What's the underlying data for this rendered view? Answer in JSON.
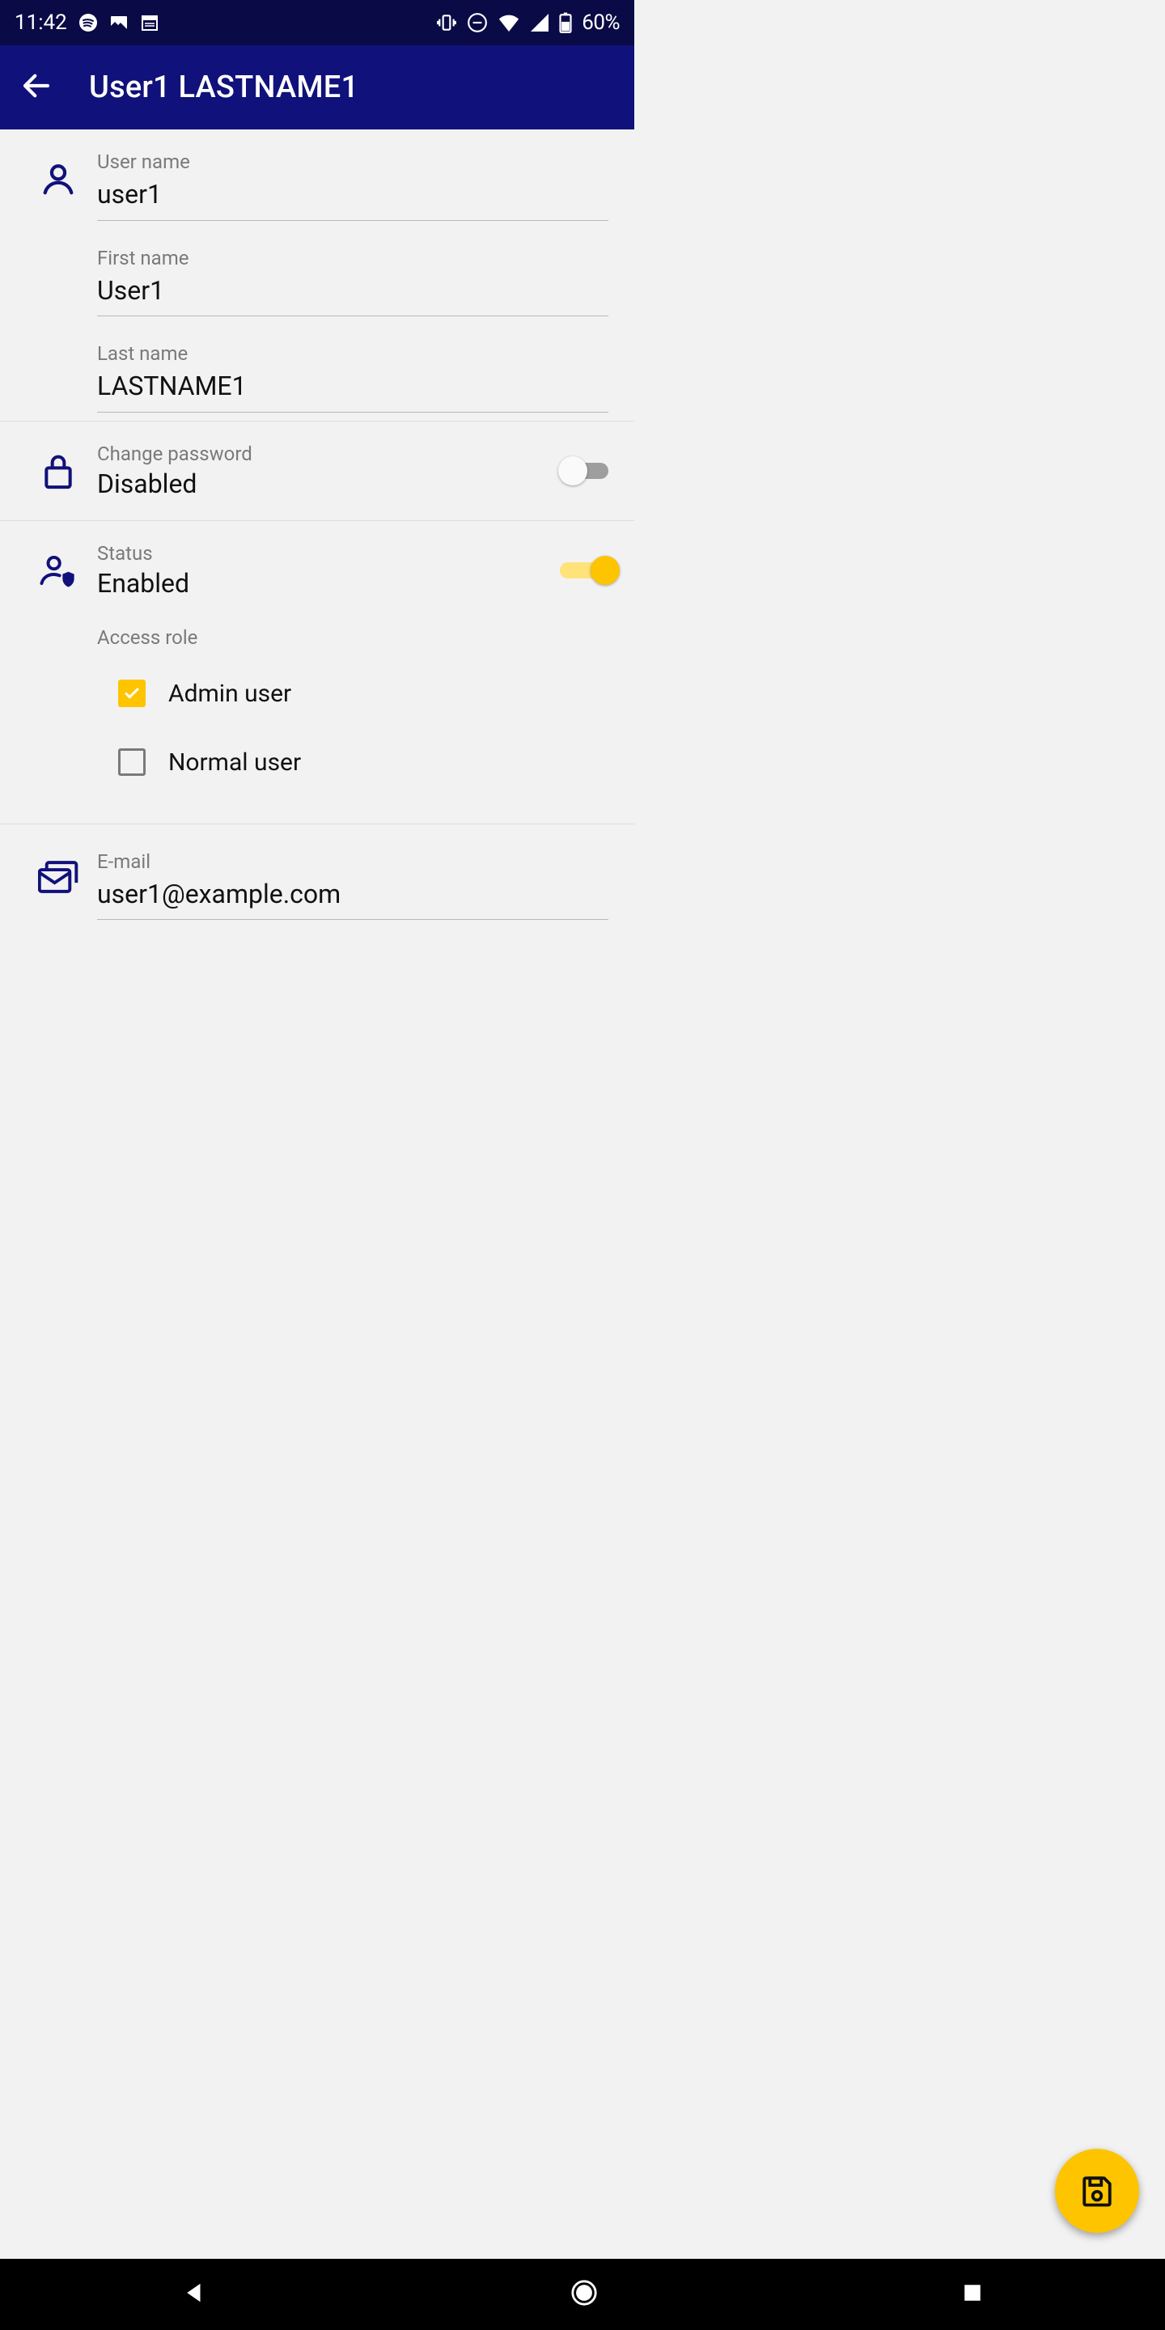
{
  "status": {
    "time": "11:42",
    "battery": "60%"
  },
  "header": {
    "title": "User1 LASTNAME1"
  },
  "fields": {
    "username_label": "User name",
    "username_value": "user1",
    "firstname_label": "First name",
    "firstname_value": "User1",
    "lastname_label": "Last name",
    "lastname_value": "LASTNAME1"
  },
  "password": {
    "label": "Change password",
    "value": "Disabled",
    "on": false
  },
  "status_toggle": {
    "label": "Status",
    "value": "Enabled",
    "on": true
  },
  "access": {
    "label": "Access role",
    "options": [
      {
        "label": "Admin user",
        "checked": true
      },
      {
        "label": "Normal user",
        "checked": false
      }
    ]
  },
  "email": {
    "label": "E-mail",
    "value": "user1@example.com"
  }
}
